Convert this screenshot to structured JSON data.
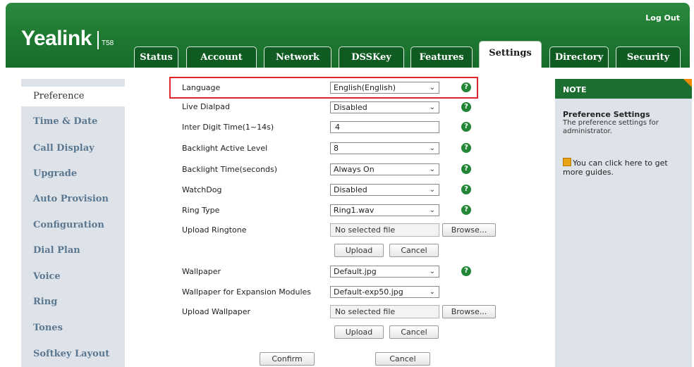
{
  "header": {
    "logout": "Log Out",
    "logo": "Yealink",
    "model": "T58",
    "tabs": [
      {
        "label": "Status"
      },
      {
        "label": "Account"
      },
      {
        "label": "Network"
      },
      {
        "label": "DSSKey"
      },
      {
        "label": "Features"
      },
      {
        "label": "Settings",
        "active": true
      },
      {
        "label": "Directory"
      },
      {
        "label": "Security"
      }
    ]
  },
  "nav": {
    "items": [
      {
        "label": "Preference",
        "active": true
      },
      {
        "label": "Time & Date"
      },
      {
        "label": "Call Display"
      },
      {
        "label": "Upgrade"
      },
      {
        "label": "Auto Provision"
      },
      {
        "label": "Configuration"
      },
      {
        "label": "Dial Plan"
      },
      {
        "label": "Voice"
      },
      {
        "label": "Ring"
      },
      {
        "label": "Tones"
      },
      {
        "label": "Softkey Layout"
      }
    ]
  },
  "form": {
    "language": {
      "label": "Language",
      "value": "English(English)"
    },
    "live_dialpad": {
      "label": "Live Dialpad",
      "value": "Disabled"
    },
    "inter_digit": {
      "label": "Inter Digit Time(1~14s)",
      "value": "4"
    },
    "backlight_level": {
      "label": "Backlight Active Level",
      "value": "8"
    },
    "backlight_time": {
      "label": "Backlight Time(seconds)",
      "value": "Always On"
    },
    "watchdog": {
      "label": "WatchDog",
      "value": "Disabled"
    },
    "ring_type": {
      "label": "Ring Type",
      "value": "Ring1.wav"
    },
    "upload_ringtone": {
      "label": "Upload Ringtone",
      "file": "No selected file",
      "browse": "Browse...",
      "upload": "Upload",
      "cancel": "Cancel"
    },
    "wallpaper": {
      "label": "Wallpaper",
      "value": "Default.jpg"
    },
    "wallpaper_exp": {
      "label": "Wallpaper for Expansion Modules",
      "value": "Default-exp50.jpg"
    },
    "upload_wallpaper": {
      "label": "Upload Wallpaper",
      "file": "No selected file",
      "browse": "Browse...",
      "upload": "Upload",
      "cancel": "Cancel"
    },
    "confirm": "Confirm",
    "cancel": "Cancel",
    "help_glyph": "?"
  },
  "note": {
    "title": "NOTE",
    "sub_title": "Preference Settings",
    "sub_text": "The preference settings for administrator.",
    "guide": "You can click here to get more guides."
  },
  "colors": {
    "header_green": "#1f7a32",
    "nav_text": "#5c7890",
    "highlight": "#e0262a",
    "panel_bg": "#dee3ea"
  }
}
